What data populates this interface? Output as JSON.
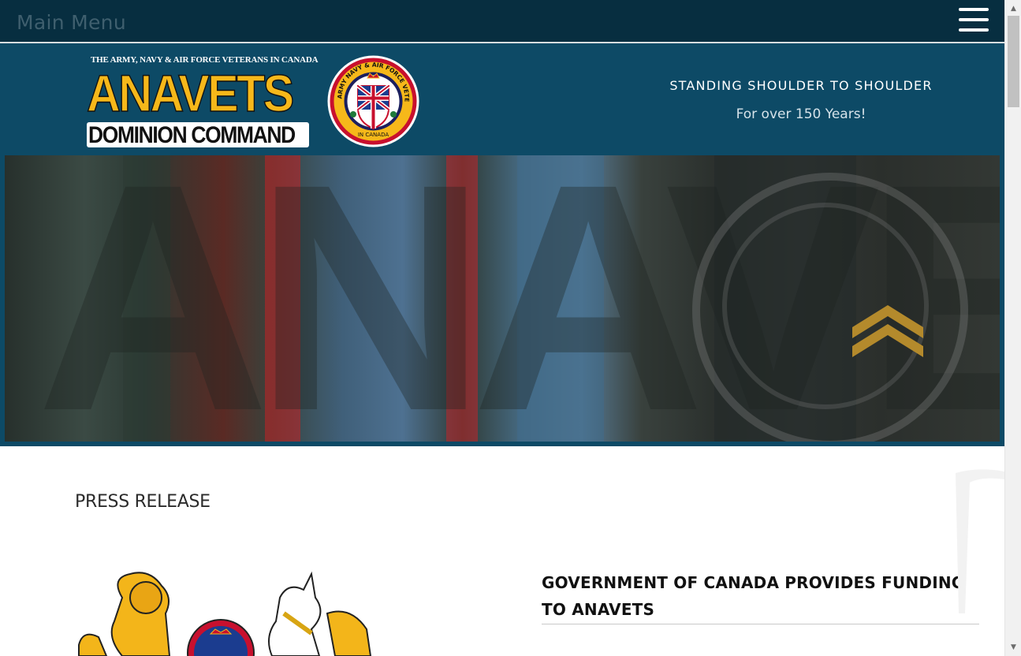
{
  "menu": {
    "label": "Main Menu",
    "toggle_icon": "hamburger-icon"
  },
  "header": {
    "logo": {
      "org_full_name": "THE ARMY, NAVY & AIR FORCE VETERANS IN CANADA",
      "acronym": "ANAVETS",
      "subtitle": "DOMINION COMMAND",
      "crest_ring_text": "ARMY NAVY & AIR FORCE VETERANS",
      "crest_bottom_text": "IN CANADA"
    },
    "tagline": "STANDING SHOULDER TO SHOULDER",
    "tagline_sub": "For over 150 Years!"
  },
  "content": {
    "section_title": "PRESS RELEASE",
    "article_title": "GOVERNMENT OF CANADA PROVIDES FUNDING TO ANAVETS"
  },
  "colors": {
    "menubar_bg": "#072e40",
    "header_bg": "#0d4a66",
    "logo_yellow": "#f6b81a",
    "page_bg": "#ffffff"
  }
}
